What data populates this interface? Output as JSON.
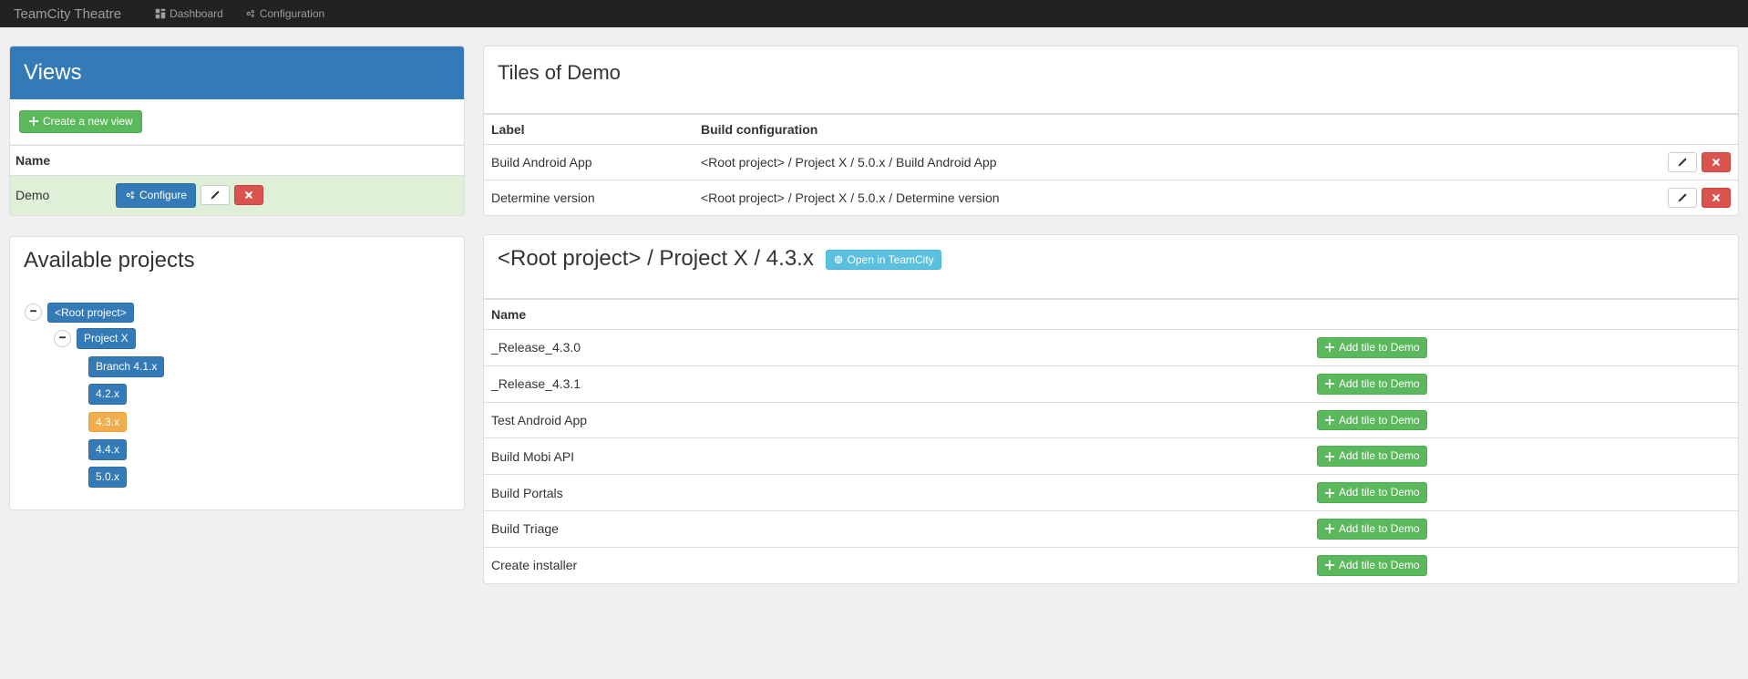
{
  "nav": {
    "brand": "TeamCity Theatre",
    "dashboard": "Dashboard",
    "configuration": "Configuration"
  },
  "views": {
    "title": "Views",
    "create_label": "Create a new view",
    "col_name": "Name",
    "rows": [
      {
        "name": "Demo",
        "configure_label": "Configure"
      }
    ]
  },
  "projects": {
    "title": "Available projects",
    "root": "<Root project>",
    "nodes": [
      {
        "label": "Project X",
        "children": [
          {
            "label": "Branch 4.1.x"
          },
          {
            "label": "4.2.x"
          },
          {
            "label": "4.3.x",
            "active": true
          },
          {
            "label": "4.4.x"
          },
          {
            "label": "5.0.x"
          }
        ]
      }
    ]
  },
  "tiles": {
    "title": "Tiles of Demo",
    "col_label": "Label",
    "col_buildcfg": "Build configuration",
    "rows": [
      {
        "label": "Build Android App",
        "cfg": "<Root project> / Project X / 5.0.x / Build Android App"
      },
      {
        "label": "Determine version",
        "cfg": "<Root project> / Project X / 5.0.x / Determine version"
      }
    ]
  },
  "selected": {
    "title": "<Root project> / Project X / 4.3.x",
    "open_label": "Open in TeamCity",
    "col_name": "Name",
    "add_label": "Add tile to Demo",
    "rows": [
      {
        "name": "_Release_4.3.0"
      },
      {
        "name": "_Release_4.3.1"
      },
      {
        "name": "Test Android App"
      },
      {
        "name": "Build Mobi API"
      },
      {
        "name": "Build Portals"
      },
      {
        "name": "Build Triage"
      },
      {
        "name": "Create installer"
      }
    ]
  }
}
